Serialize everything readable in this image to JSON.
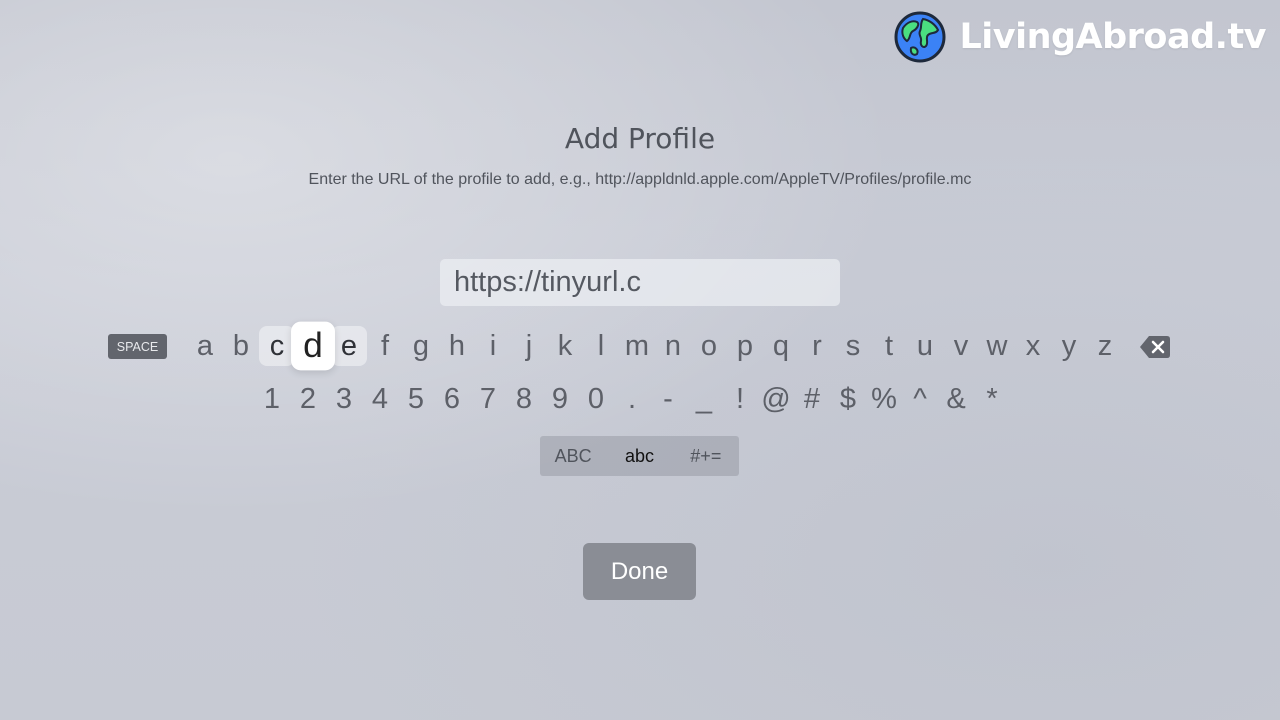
{
  "brand": {
    "name": "LivingAbroad.tv",
    "icon": "globe-icon",
    "colors": {
      "ocean": "#3b82f6",
      "land": "#4ade80",
      "outline": "#1e293b"
    }
  },
  "dialog": {
    "title": "Add Profile",
    "instructions": "Enter the URL of the profile to add, e.g., http://appldnld.apple.com/AppleTV/Profiles/profile.mc"
  },
  "url_field": {
    "value": "https://tinyurl.c"
  },
  "keyboard": {
    "space_label": "SPACE",
    "delete_icon": "backspace-icon",
    "letters": [
      "a",
      "b",
      "c",
      "d",
      "e",
      "f",
      "g",
      "h",
      "i",
      "j",
      "k",
      "l",
      "m",
      "n",
      "o",
      "p",
      "q",
      "r",
      "s",
      "t",
      "u",
      "v",
      "w",
      "x",
      "y",
      "z"
    ],
    "digits": [
      "1",
      "2",
      "3",
      "4",
      "5",
      "6",
      "7",
      "8",
      "9",
      "0",
      ".",
      "-",
      "_",
      "!",
      "@",
      "#",
      "$",
      "%",
      "^",
      "&",
      "*"
    ],
    "focused_key": "d",
    "neighbor_keys": [
      "c",
      "e"
    ],
    "modes": [
      {
        "label": "ABC",
        "active": false
      },
      {
        "label": "abc",
        "active": true
      },
      {
        "label": "#+=",
        "active": false
      }
    ]
  },
  "done_button": {
    "label": "Done"
  }
}
